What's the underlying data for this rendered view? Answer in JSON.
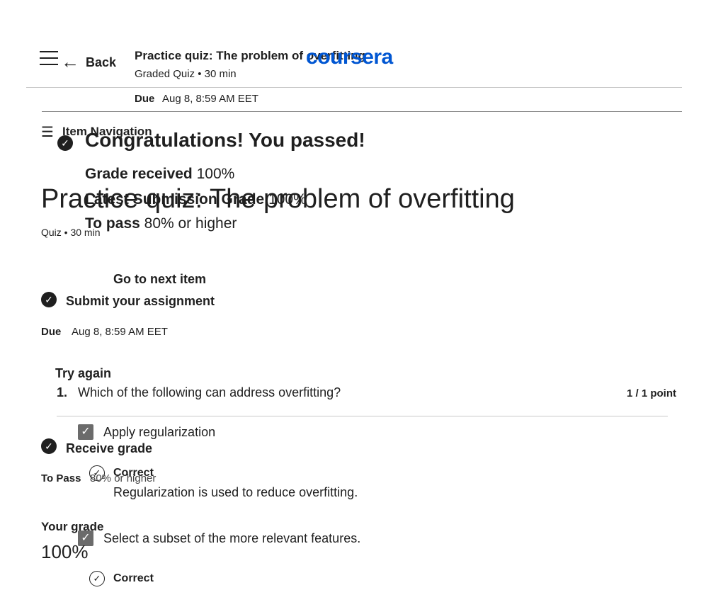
{
  "header": {
    "back_label": "Back",
    "title": "Practice quiz: The problem of overfitting",
    "subtitle": "Graded Quiz • 30 min",
    "logo_text": "coursera",
    "due_label": "Due",
    "due_value": "Aug 8, 8:59 AM EET"
  },
  "sidebar": {
    "item_navigation_label": "Item Navigation"
  },
  "result": {
    "heading": "Congratulations! You passed!",
    "grade_received_label": "Grade received",
    "grade_received_value": "100%",
    "latest_label": "Latest Submission Grade",
    "latest_value": "100%",
    "to_pass_label": "To pass",
    "to_pass_value": "80% or higher",
    "next_button": "Go to next item"
  },
  "page": {
    "title": "Practice quiz: The problem of overfitting",
    "meta": "Quiz • 30 min"
  },
  "submit": {
    "label": "Submit your assignment",
    "due_label": "Due",
    "due_value": "Aug 8, 8:59 AM EET",
    "try_again": "Try again"
  },
  "receive": {
    "label": "Receive grade",
    "to_pass_label": "To Pass",
    "to_pass_value": "80% or higher",
    "your_grade_label": "Your grade",
    "your_grade_value": "100%"
  },
  "question": {
    "number": "1.",
    "text": "Which of the following can address overfitting?",
    "points": "1 / 1 point",
    "options": [
      {
        "label": "Apply regularization",
        "checked": true,
        "feedback_title": "Correct",
        "feedback_text": "Regularization is used to reduce overfitting."
      },
      {
        "label": "Select a subset of the more relevant features.",
        "checked": true,
        "feedback_title": "Correct"
      }
    ]
  },
  "colors": {
    "brand": "#0056d2",
    "text": "#1f1f1f",
    "divider": "#c9c9c9",
    "checkbox": "#6b6b6b"
  }
}
